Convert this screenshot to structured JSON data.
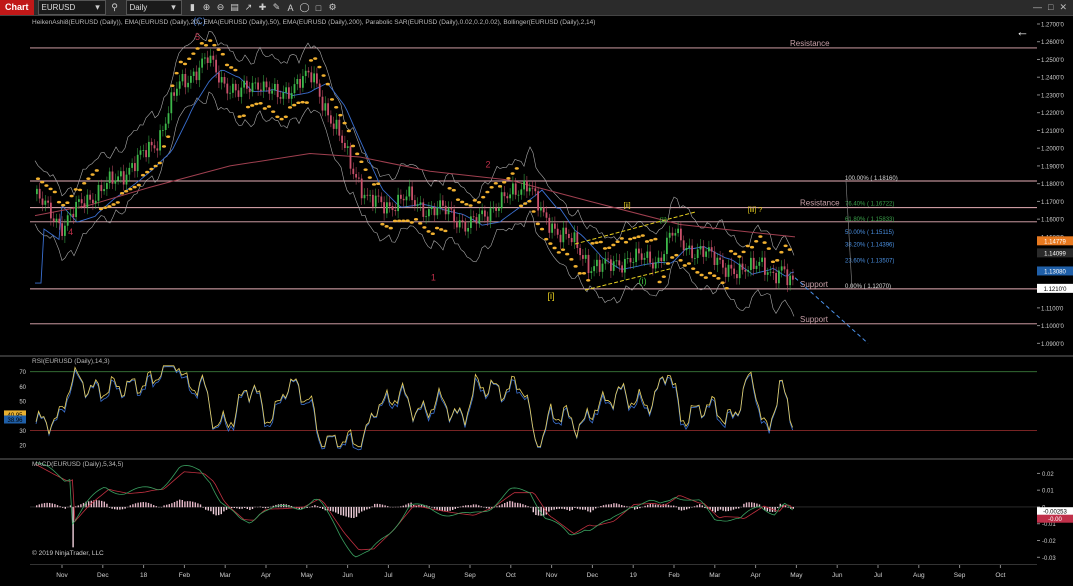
{
  "toolbar": {
    "chart_label": "Chart",
    "instrument": "EURUSD",
    "timeframe": "Daily"
  },
  "price_panel": {
    "indicator_label": "HeikenAshi8(EURUSD (Daily)), EMA(EURUSD (Daily),20), EMA(EURUSD (Daily),50), EMA(EURUSD (Daily),200), Parabolic SAR(EURUSD (Daily),0.02,0.2,0.02), Bollinger(EURUSD (Daily),2,14)",
    "y_ticks": [
      "1.2700'0",
      "1.2600'0",
      "1.2500'0",
      "1.2400'0",
      "1.2300'0",
      "1.2200'0",
      "1.2100'0",
      "1.2000'0",
      "1.1900'0",
      "1.1800'0",
      "1.1700'0",
      "1.1600'0",
      "1.1500'0",
      "1.1400'0",
      "1.1300'0",
      "1.1200'0",
      "1.1100'0",
      "1.1000'0",
      "1.0900'0"
    ],
    "y_tick_values": [
      1.27,
      1.26,
      1.25,
      1.24,
      1.23,
      1.22,
      1.21,
      1.2,
      1.19,
      1.18,
      1.17,
      1.16,
      1.15,
      1.14,
      1.13,
      1.12,
      1.11,
      1.1,
      1.09
    ],
    "price_tags": [
      {
        "text": "1.14779",
        "value": 1.14779,
        "color": "#e8791f"
      },
      {
        "text": "1.14099",
        "value": 1.14099,
        "color": "#2a2a2a"
      },
      {
        "text": "1.13080",
        "value": 1.1308,
        "color": "#1f5fa8"
      },
      {
        "text": "1.1210'0",
        "value": 1.121,
        "color": "#ffffff"
      }
    ],
    "horizontal_levels": [
      {
        "label": "Resistance",
        "value": 1.2565,
        "label_pos": "left-of-mid"
      },
      {
        "label": "",
        "value": 1.1815
      },
      {
        "label": "Resistance",
        "value": 1.1665,
        "label_pos": "mid"
      },
      {
        "label": "",
        "value": 1.1585
      },
      {
        "label": "Support",
        "value": 1.1207,
        "label_pos": "mid"
      },
      {
        "label": "Support",
        "value": 1.101,
        "label_pos": "mid"
      }
    ],
    "fib_levels": [
      {
        "label": "100.00% ( 1.18160)",
        "value": 1.1816,
        "color": "#dddddd"
      },
      {
        "label": "76.40% ( 1.16722)",
        "value": 1.16722,
        "color": "#3aa04a"
      },
      {
        "label": "61.80% ( 1.15833)",
        "value": 1.15833,
        "color": "#3aa04a"
      },
      {
        "label": "50.00% ( 1.15115)",
        "value": 1.15115,
        "color": "#4a8fe0"
      },
      {
        "label": "38.20% ( 1.14396)",
        "value": 1.14396,
        "color": "#4a8fe0"
      },
      {
        "label": "23.60% ( 1.13507)",
        "value": 1.13507,
        "color": "#4a8fe0"
      },
      {
        "label": "0.00% ( 1.12070)",
        "value": 1.1207,
        "color": "#dddddd"
      }
    ],
    "wave_labels": [
      {
        "text": "(C)",
        "color": "#4a7fd6",
        "x_idx": 0.165,
        "value": 1.27
      },
      {
        "text": "5",
        "color": "#c0304a",
        "x_idx": 0.167,
        "value": 1.261
      },
      {
        "text": "4",
        "color": "#c0304a",
        "x_idx": 0.032,
        "value": 1.151
      },
      {
        "text": "2",
        "color": "#c0304a",
        "x_idx": 0.476,
        "value": 1.189
      },
      {
        "text": "1",
        "color": "#c0304a",
        "x_idx": 0.418,
        "value": 1.1255
      },
      {
        "text": "[i]",
        "color": "#e8d020",
        "x_idx": 0.542,
        "value": 1.115
      },
      {
        "text": "[ii]",
        "color": "#e8d020",
        "x_idx": 0.623,
        "value": 1.1665
      },
      {
        "text": "(ii)",
        "color": "#3fbf3f",
        "x_idx": 0.661,
        "value": 1.158
      },
      {
        "text": "(i)",
        "color": "#3fbf3f",
        "x_idx": 0.639,
        "value": 1.1235
      },
      {
        "text": "[iii] ?",
        "color": "#e8d020",
        "x_idx": 0.755,
        "value": 1.164
      }
    ]
  },
  "rsi_panel": {
    "label": "RSI(EURUSD (Daily),14,3)",
    "y_ticks": [
      "70",
      "60",
      "50",
      "40",
      "30",
      "20"
    ],
    "y_tick_values": [
      70,
      60,
      50,
      40,
      30,
      20
    ],
    "tags": [
      {
        "text": "40.95",
        "value": 40.95,
        "color": "#e8b030"
      },
      {
        "text": "38.96",
        "value": 37.5,
        "color": "#1f5fa8"
      }
    ],
    "levels": [
      70,
      30
    ]
  },
  "macd_panel": {
    "label": "MACD(EURUSD (Daily),5,34,5)",
    "y_ticks": [
      "0.02",
      "0.01",
      "0",
      "-0.01",
      "-0.02",
      "-0.03"
    ],
    "y_tick_values": [
      0.02,
      0.01,
      0,
      -0.01,
      -0.02,
      -0.03
    ],
    "tags": [
      {
        "text": "-0.00253",
        "value": -0.00253,
        "color": "#ffffff"
      },
      {
        "text": "-0.00",
        "value": -0.007,
        "color": "#c0304a"
      }
    ],
    "copyright": "© 2019 NinjaTrader, LLC"
  },
  "x_axis": {
    "labels": [
      "Nov",
      "Dec",
      "18",
      "Feb",
      "Mar",
      "Apr",
      "May",
      "Jun",
      "Jul",
      "Aug",
      "Sep",
      "Oct",
      "Nov",
      "Dec",
      "19",
      "Feb",
      "Mar",
      "Apr",
      "May",
      "Jun",
      "Jul",
      "Aug",
      "Sep",
      "Oct"
    ]
  },
  "colors": {
    "bull": "#3cb84a",
    "bear": "#c8506a",
    "sar": "#f0b030",
    "ema_blue": "#3a6fd0",
    "ema_red": "#a04050",
    "bollinger": "#aaaaaa",
    "level": "#e8b0b8"
  },
  "icons": [
    "chevron-down-icon",
    "search-icon",
    "crosshair-icon",
    "zoom-in-icon",
    "zoom-out-icon",
    "pointer-icon",
    "draw-icon",
    "settings-icon",
    "back-arrow-icon"
  ]
}
